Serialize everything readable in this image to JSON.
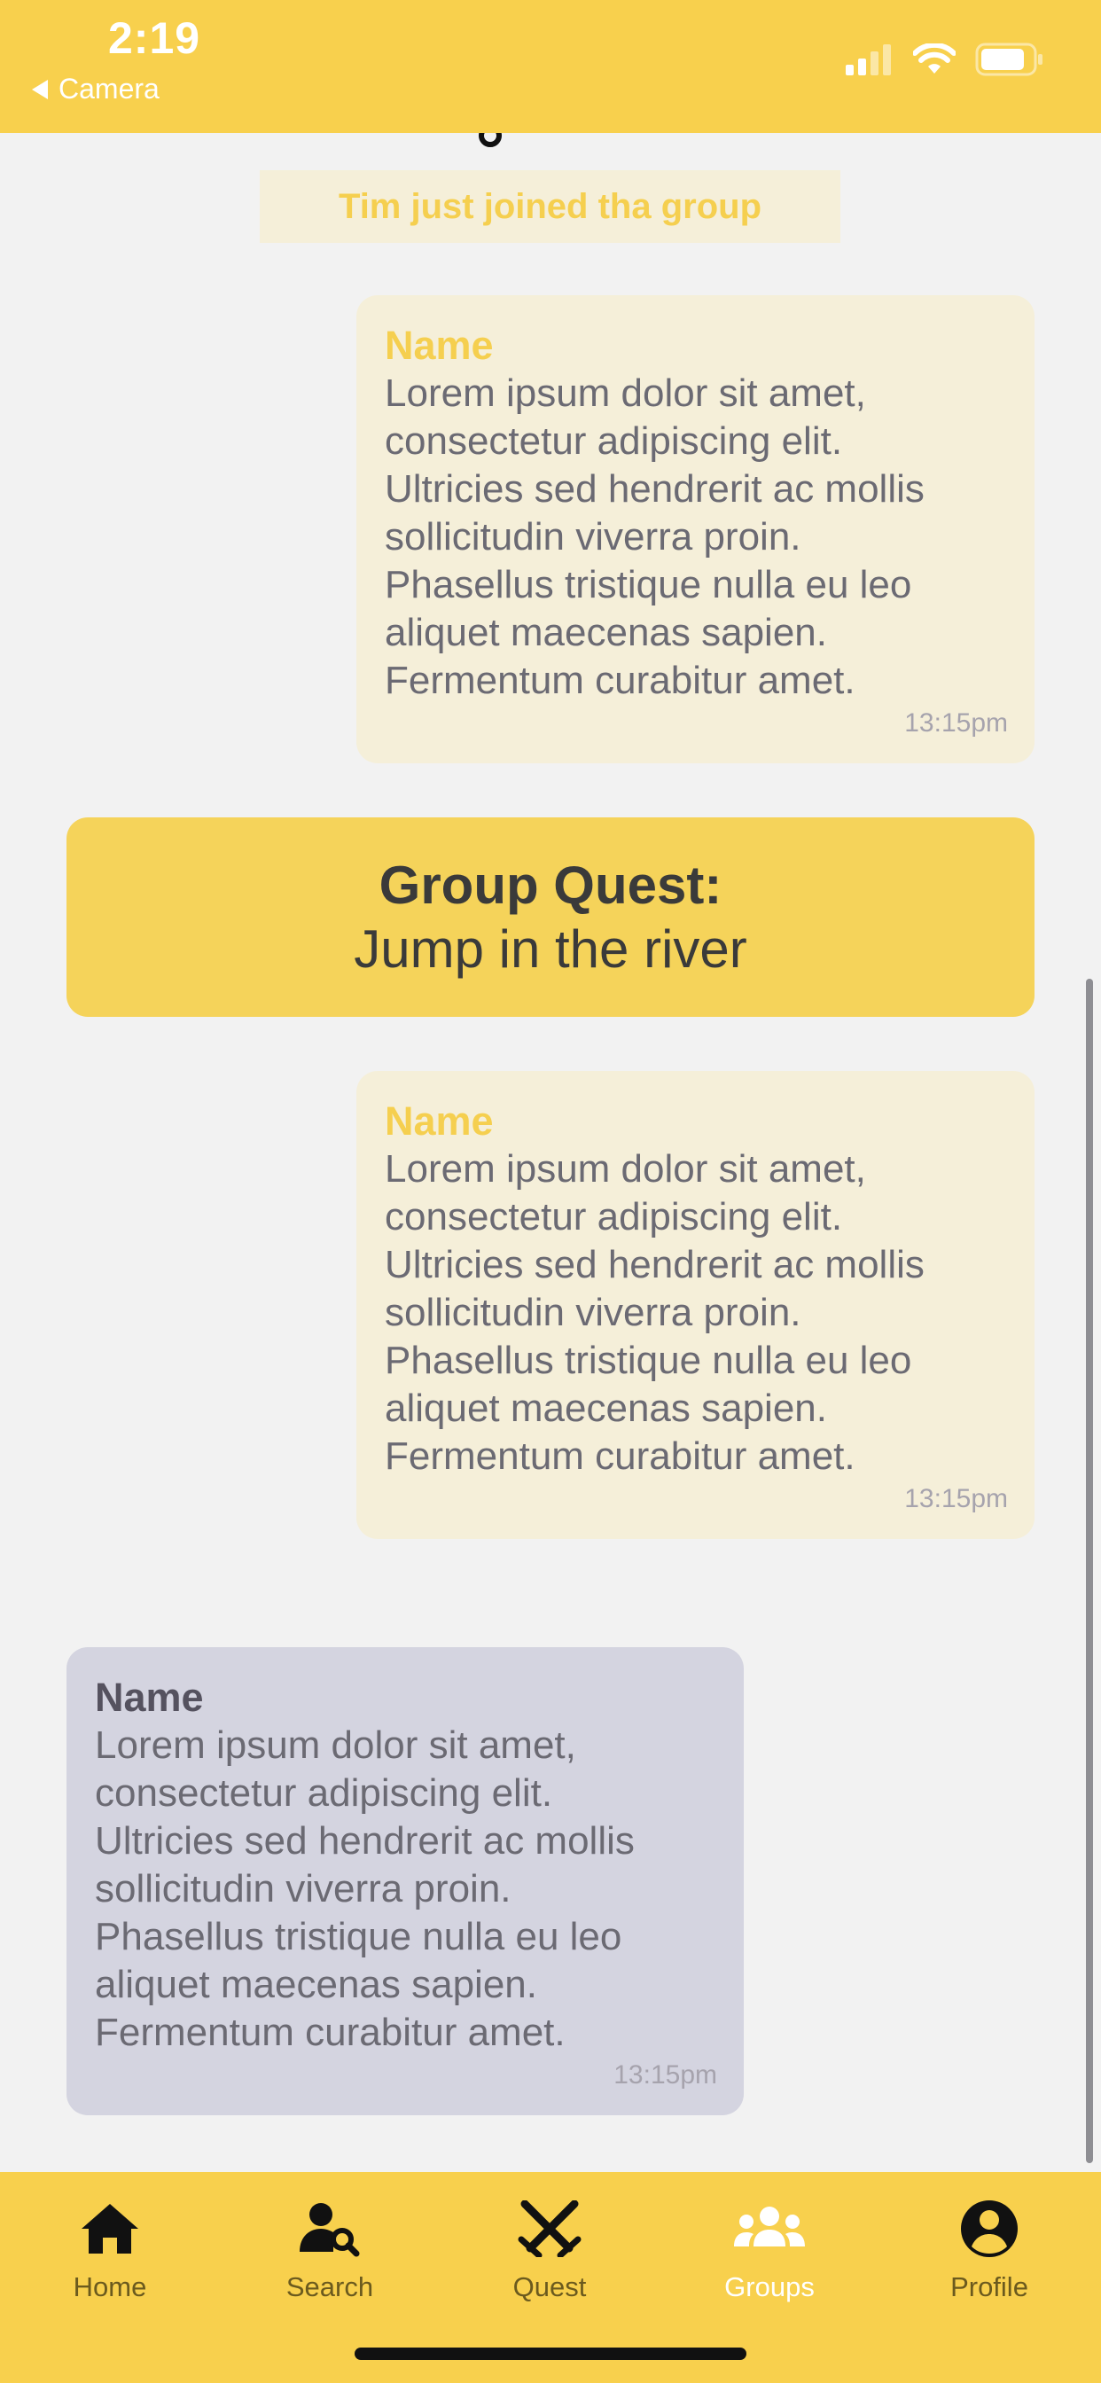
{
  "status_bar": {
    "time": "2:19",
    "back_app": "Camera"
  },
  "chat": {
    "system_message": "Tim just joined tha group",
    "messages": [
      {
        "sender": "Name",
        "text": "Lorem ipsum dolor sit amet,\nconsectetur adipiscing elit.\nUltricies sed hendrerit ac mollis\nsollicitudin viverra proin.\nPhasellus tristique nulla eu leo\naliquet maecenas sapien.\nFermentum curabitur amet.",
        "time": "13:15pm"
      },
      {
        "sender": "Name",
        "text": "Lorem ipsum dolor sit amet,\nconsectetur adipiscing elit.\nUltricies sed hendrerit ac mollis\nsollicitudin viverra proin.\nPhasellus tristique nulla eu leo\naliquet maecenas sapien.\nFermentum curabitur amet.",
        "time": "13:15pm"
      },
      {
        "sender": "Name",
        "text": "Lorem ipsum dolor sit amet,\nconsectetur adipiscing elit.\nUltricies sed hendrerit ac mollis\nsollicitudin viverra proin.\nPhasellus tristique nulla eu leo\naliquet maecenas sapien.\nFermentum curabitur amet.",
        "time": "13:15pm"
      }
    ],
    "quest": {
      "title": "Group Quest:",
      "task": "Jump in the river"
    }
  },
  "tabs": [
    {
      "label": "Home",
      "icon": "home-icon",
      "active": false
    },
    {
      "label": "Search",
      "icon": "user-search-icon",
      "active": false
    },
    {
      "label": "Quest",
      "icon": "crossed-swords-icon",
      "active": false
    },
    {
      "label": "Groups",
      "icon": "group-icon",
      "active": true
    },
    {
      "label": "Profile",
      "icon": "profile-icon",
      "active": false
    }
  ],
  "colors": {
    "accent": "#f8d04d",
    "incoming_bubble": "#f5efd9",
    "outgoing_bubble": "#d4d4e0",
    "background": "#f2f2f2"
  }
}
